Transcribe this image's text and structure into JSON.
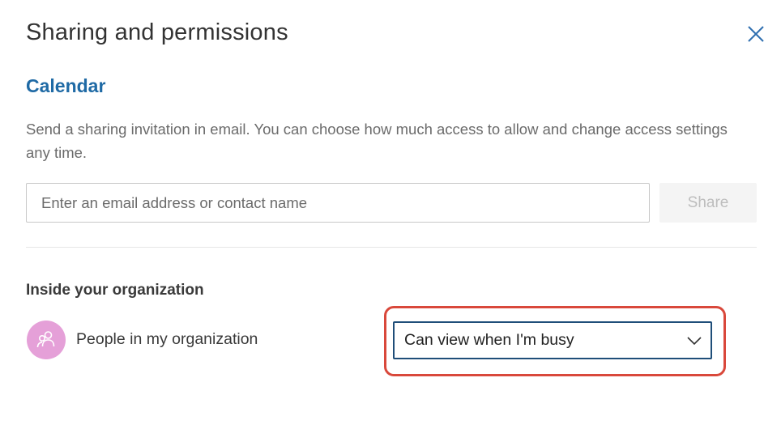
{
  "dialog": {
    "title": "Sharing and permissions",
    "close_icon": "close-icon"
  },
  "calendar": {
    "heading": "Calendar",
    "description": "Send a sharing invitation in email. You can choose how much access to allow and change access settings any time.",
    "email_input": {
      "value": "",
      "placeholder": "Enter an email address or contact name"
    },
    "share_button": {
      "label": "Share",
      "state": "disabled"
    }
  },
  "organization": {
    "heading": "Inside your organization",
    "entries": [
      {
        "avatar_icon": "people-group-icon",
        "name": "People in my organization",
        "permission": "Can view when I'm busy",
        "dropdown_icon": "chevron-down-icon"
      }
    ]
  },
  "colors": {
    "heading_accent": "#1f6aa5",
    "select_border": "#1f4e79",
    "highlight": "#d9483b",
    "avatar_bg": "#e5a0d8"
  }
}
